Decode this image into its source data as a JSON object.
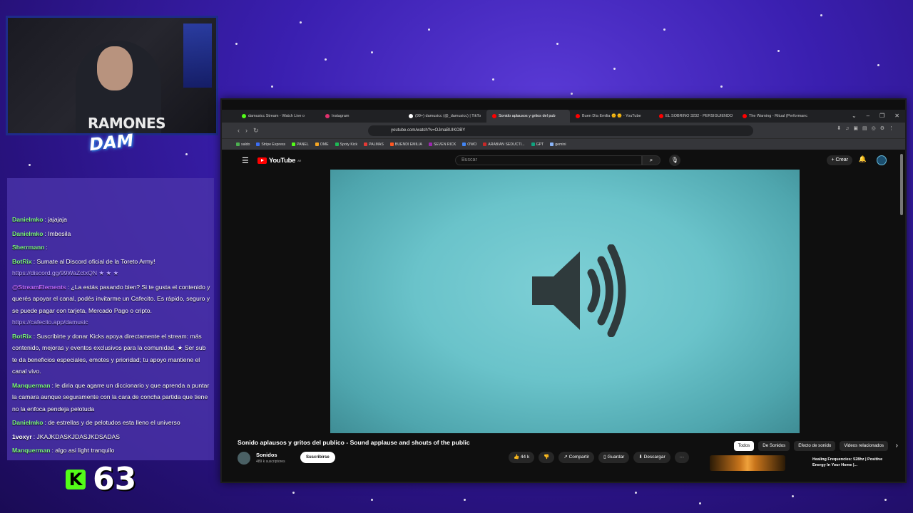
{
  "webcam": {
    "shirt_text": "RAMONES",
    "logo_text": "DAM"
  },
  "chat": {
    "messages": [
      {
        "user": "Danielmko",
        "user_color": "#7cf77c",
        "text": ": jajajaja"
      },
      {
        "user": "Danielmko",
        "user_color": "#7cf77c",
        "text": ": Imbesila"
      },
      {
        "user": "Sherrmann",
        "user_color": "#7cf77c",
        "text": ": "
      },
      {
        "user": "BotRix",
        "user_color": "#7cf77c",
        "text": ": Sumate al Discord oficial de la Toreto Army!",
        "link": "https://discord.gg/99WaZctxQN ★ ★ ★"
      },
      {
        "user": "@StreamElements",
        "user_color": "#c46bff",
        "text": ": ¿La estás pasando bien? Si te gusta el contenido y querés apoyar el canal, podés invitarme un Cafecito. Es rápido, seguro y se puede pagar con tarjeta, Mercado Pago o cripto.",
        "link": "https://cafecito.app/damusic"
      },
      {
        "user": "BotRix",
        "user_color": "#7cf77c",
        "text": ": Suscribirte y donar Kicks apoya directamente el stream: más contenido, mejoras y eventos exclusivos para la comunidad. ★ Ser sub te da beneficios especiales, emotes y prioridad; tu apoyo mantiene el canal vivo."
      },
      {
        "user": "Manquerman",
        "user_color": "#7cf77c",
        "text": ": le diria que agarre un diccionario y que aprenda a puntar la camara aunque seguramente con la cara de concha partida que tiene no la enfoca pendeja pelotuda"
      },
      {
        "user": "Danielmko",
        "user_color": "#7cf77c",
        "text": ": de estrellas y de pelotudos esta lleno el universo"
      },
      {
        "user": "1voxyr",
        "user_color": "#ffffff",
        "text": ": JKAJKDASKJDASJKDSADAS"
      },
      {
        "user": "Manquerman",
        "user_color": "#7cf77c",
        "text": ": algo asi light tranquilo"
      }
    ]
  },
  "kicks": {
    "icon": "K",
    "count": "63"
  },
  "browser": {
    "tabs": [
      {
        "label": "damusicc Stream - Watch Live o",
        "color": "#53fc18"
      },
      {
        "label": "Instagram",
        "color": "#e1306c"
      },
      {
        "label": "(99+) damusicc (@_damusicc) | TikTo",
        "color": "#ffffff"
      },
      {
        "label": "Sonido aplausos y gritos del pub",
        "color": "#ff0000",
        "active": true
      },
      {
        "label": "Buen Día Emilia 🌞 🌞 - YouTube",
        "color": "#ff0000"
      },
      {
        "label": "EL SOBRINO 3232 - PERSIGUIENDO",
        "color": "#ff0000"
      },
      {
        "label": "The Warning - Ritual (Performanc",
        "color": "#ff0000"
      }
    ],
    "url": "youtube.com/watch?v=OJmaBUIKOBY",
    "bookmarks": [
      "saldo",
      "Stripe Express",
      "PANEL",
      "OME",
      "Spoty Kick",
      "PALMAS",
      "BUENDI EMILIA",
      "SEVEN RICK",
      "OWO",
      "ARABIAN SEDUCTI...",
      "GPT",
      "gemini"
    ]
  },
  "youtube": {
    "logo": "YouTube",
    "region": "AR",
    "search_placeholder": "Buscar",
    "create_label": "+ Crear",
    "video_title": "Sonido aplausos y gritos del publico - Sound applause and shouts of the public",
    "channel_name": "Sonidos",
    "channel_subs": "489 k suscriptores",
    "subscribe_label": "Suscribirse",
    "likes": "44 k",
    "share_label": "Compartir",
    "save_label": "Guardar",
    "download_label": "Descargar",
    "more_label": "···",
    "chips": [
      "Todos",
      "De Sonidos",
      "Efecto de sonido",
      "Videos relacionados"
    ],
    "related_title": "Healing Frequencies: 528hz | Positive Energy In Your Home |..."
  }
}
